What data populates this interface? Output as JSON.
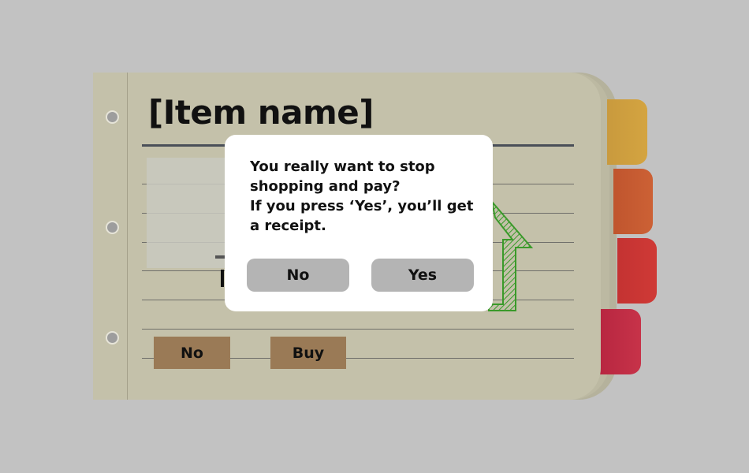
{
  "notebook": {
    "title": "[Item name]",
    "buttons": {
      "no_label": "No",
      "buy_label": "Buy"
    },
    "tabs": [
      {
        "color": "#c99a3e"
      },
      {
        "color": "#c55a30"
      },
      {
        "color": "#c83535"
      },
      {
        "color": "#bd2a48"
      }
    ],
    "arrow_icon": "green-up-arrow-icon"
  },
  "dialog": {
    "lines": [
      "You really want to stop",
      "shopping and pay?",
      "If you press ‘Yes’, you’ll get",
      "a receipt."
    ],
    "no_label": "No",
    "yes_label": "Yes"
  },
  "colors": {
    "background": "#c2c2c2",
    "page": "#c4c1aa",
    "dialog": "#ffffff",
    "dialog_button": "#b4b4b4",
    "action_button": "#9a7a56",
    "arrow": "#3a9a2a"
  }
}
